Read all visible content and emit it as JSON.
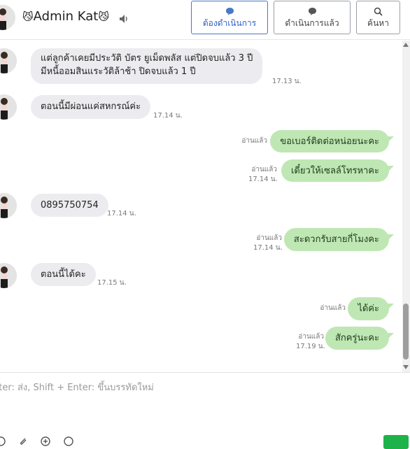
{
  "header": {
    "name": "Admin Kat",
    "cat_emoji": "😼",
    "buttons": [
      {
        "label": "ต้องดำเนินการ",
        "icon": "speech-bubble-icon"
      },
      {
        "label": "ดำเนินการแล้ว",
        "icon": "speech-bubble-icon"
      },
      {
        "label": "ค้นหา",
        "icon": "search-icon"
      }
    ]
  },
  "messages": [
    {
      "side": "in",
      "text_line1": "แต่ลูกค้าเคยมีประวัติ บัตร ยูเม็ดพลัส  แต่ปิดจบแล้ว 3 ปี",
      "text_line2": "มีหนี้ออมสินแระวัติล้าช้า ปิดจบแล้ว 1 ปี",
      "time": "17.13 น."
    },
    {
      "side": "in",
      "text": "ตอนนี้มีผ่อนแค่สหกรณ์ค่ะ",
      "time": "17.14 น."
    },
    {
      "side": "out",
      "text": "ขอเบอร์ติดต่อหน่อยนะคะ",
      "read": "อ่านแล้ว"
    },
    {
      "side": "out",
      "text": "เดี๋ยวให้เซลล์โทรหาคะ",
      "read": "อ่านแล้ว",
      "time": "17.14 น."
    },
    {
      "side": "in",
      "text": "0895750754",
      "time": "17.14 น."
    },
    {
      "side": "out",
      "text": "สะดวกรับสายกี่โมงคะ",
      "read": "อ่านแล้ว",
      "time": "17.14 น."
    },
    {
      "side": "in",
      "text": "ตอนนี้ได้คะ",
      "time": "17.15 น."
    },
    {
      "side": "out",
      "text": "ได้ค่ะ",
      "read": "อ่านแล้ว"
    },
    {
      "side": "out",
      "text": "สักครู่นะคะ",
      "read": "อ่านแล้ว",
      "time": "17.19 น."
    }
  ],
  "composer": {
    "placeholder": "nter: ส่ง, Shift + Enter: ขึ้นบรรทัดใหม่"
  },
  "colors": {
    "outgoing_bubble": "#bfe7b4",
    "incoming_bubble": "#ececf0",
    "active_button": "#2f62c5",
    "send_button": "#1db34a"
  }
}
